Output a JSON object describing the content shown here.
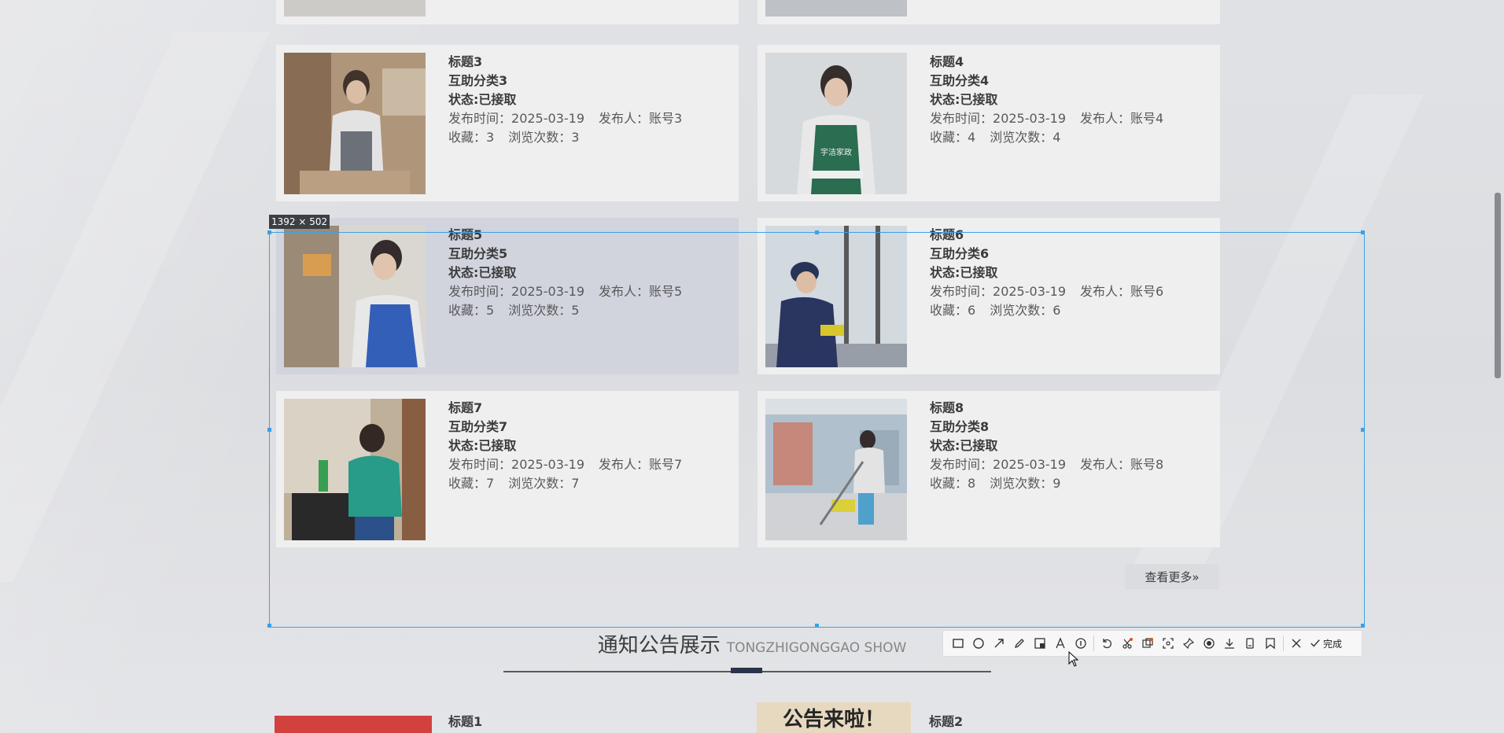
{
  "cards": [
    {
      "title": "标题3",
      "category": "互助分类3",
      "status": "状态:已接取",
      "publish_label": "发布时间：",
      "publish_date": "2025-03-19",
      "publisher_label": "发布人：",
      "publisher": "账号3",
      "fav_label": "收藏：",
      "fav": "3",
      "views_label": "浏览次数：",
      "views": "3"
    },
    {
      "title": "标题4",
      "category": "互助分类4",
      "status": "状态:已接取",
      "publish_label": "发布时间：",
      "publish_date": "2025-03-19",
      "publisher_label": "发布人：",
      "publisher": "账号4",
      "fav_label": "收藏：",
      "fav": "4",
      "views_label": "浏览次数：",
      "views": "4"
    },
    {
      "title": "标题5",
      "category": "互助分类5",
      "status": "状态:已接取",
      "publish_label": "发布时间：",
      "publish_date": "2025-03-19",
      "publisher_label": "发布人：",
      "publisher": "账号5",
      "fav_label": "收藏：",
      "fav": "5",
      "views_label": "浏览次数：",
      "views": "5"
    },
    {
      "title": "标题6",
      "category": "互助分类6",
      "status": "状态:已接取",
      "publish_label": "发布时间：",
      "publish_date": "2025-03-19",
      "publisher_label": "发布人：",
      "publisher": "账号6",
      "fav_label": "收藏：",
      "fav": "6",
      "views_label": "浏览次数：",
      "views": "6"
    },
    {
      "title": "标题7",
      "category": "互助分类7",
      "status": "状态:已接取",
      "publish_label": "发布时间：",
      "publish_date": "2025-03-19",
      "publisher_label": "发布人：",
      "publisher": "账号7",
      "fav_label": "收藏：",
      "fav": "7",
      "views_label": "浏览次数：",
      "views": "7"
    },
    {
      "title": "标题8",
      "category": "互助分类8",
      "status": "状态:已接取",
      "publish_label": "发布时间：",
      "publish_date": "2025-03-19",
      "publisher_label": "发布人：",
      "publisher": "账号8",
      "fav_label": "收藏：",
      "fav": "8",
      "views_label": "浏览次数：",
      "views": "9"
    }
  ],
  "more_button": "查看更多»",
  "notice_section": {
    "title_zh": "通知公告展示",
    "title_en": "TONGZHIGONGGAO SHOW",
    "items": [
      {
        "title": "标题1"
      },
      {
        "title": "标题2",
        "image_text": "公告来啦！"
      }
    ]
  },
  "screenshot_tool": {
    "size_label": "1392 × 502",
    "done_label": "完成",
    "tools": [
      "rectangle-icon",
      "ellipse-icon",
      "arrow-icon",
      "pen-icon",
      "mosaic-icon",
      "text-icon",
      "number-icon",
      "undo-icon",
      "crop-icon",
      "ocr-icon",
      "scroll-capture-icon",
      "pin-icon",
      "record-icon",
      "save-icon",
      "phone-icon",
      "bookmark-icon",
      "close-icon",
      "check-icon"
    ],
    "accent_color": "#3aa0ea"
  }
}
